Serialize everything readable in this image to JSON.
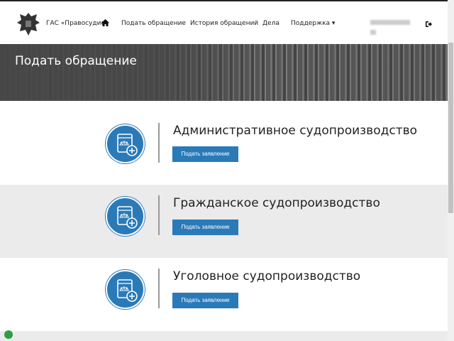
{
  "header": {
    "brand": "ГАС «Правосудие»",
    "nav": [
      "Подать обращение",
      "История обращений",
      "Дела",
      "Поддержка ▾"
    ]
  },
  "banner": {
    "title": "Подать обращение"
  },
  "sections": [
    {
      "title": "Административное судопроизводство",
      "button": "Подать заявление"
    },
    {
      "title": "Гражданское судопроизводство",
      "button": "Подать заявление"
    },
    {
      "title": "Уголовное судопроизводство",
      "button": "Подать заявление"
    }
  ],
  "colors": {
    "accent": "#2a7ab8",
    "alt_bg": "#ebebeb"
  }
}
